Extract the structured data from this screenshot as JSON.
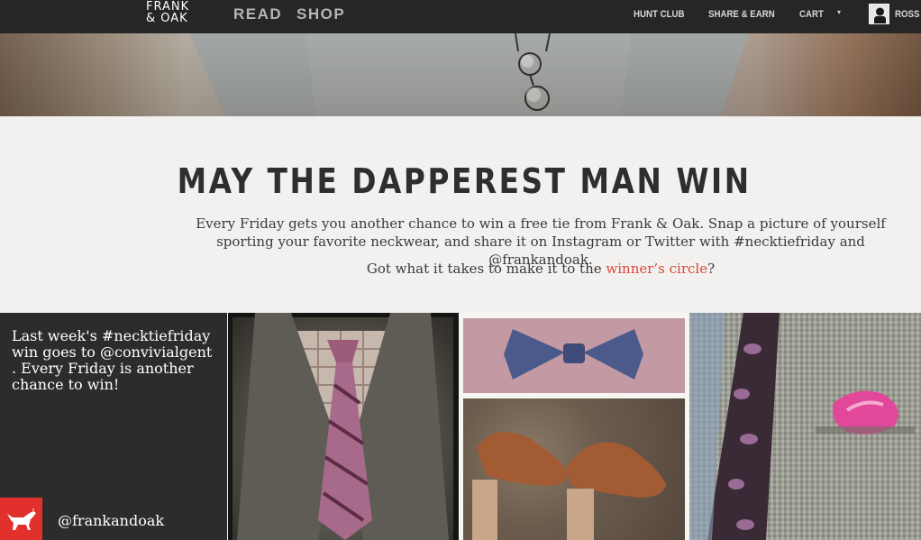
{
  "nav": {
    "logo_line1": "FRANK",
    "logo_line2": "& OAK",
    "read": "READ",
    "shop": "SHOP",
    "hunt_club": "HUNT CLUB",
    "share_earn": "SHARE & EARN",
    "cart": "CART",
    "user": "ROSS"
  },
  "main": {
    "headline": "MAY THE DAPPEREST MAN WIN",
    "intro": "Every Friday gets you another chance to win a free tie from Frank & Oak. Snap a picture of yourself sporting your favorite neckwear, and share it on Instagram or Twitter with #necktiefriday and @frankandoak.",
    "cta_before": "Got what it takes to make it to the ",
    "cta_link": "winner’s circle",
    "cta_after": "?"
  },
  "promo": {
    "text": "Last week's #necktiefriday win goes to @convivialgent . Every Friday is another chance to win!",
    "handle": "@frankandoak"
  },
  "colors": {
    "nav_bg": "#262626",
    "accent": "#d9473a",
    "brand_red": "#e2302d",
    "panel_bg": "#2c2c2c",
    "page_bg": "#f3f1ef"
  },
  "icons": [
    "caret-down-icon",
    "frank-and-oak-dog-logo"
  ]
}
